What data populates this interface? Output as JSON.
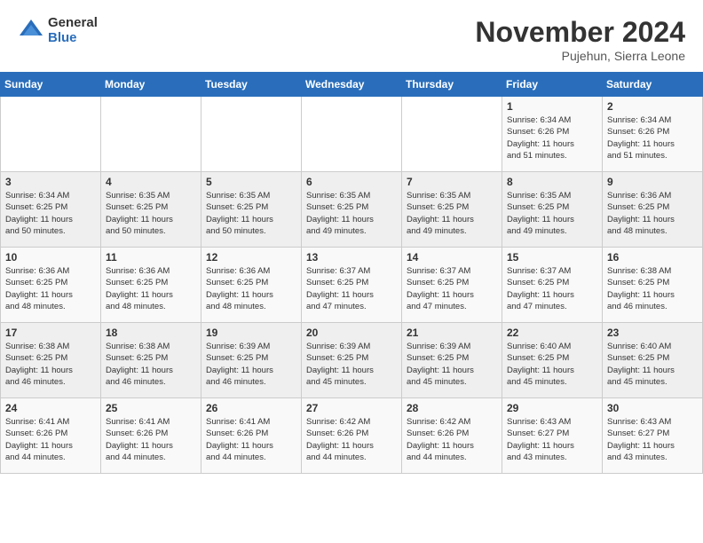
{
  "header": {
    "logo_general": "General",
    "logo_blue": "Blue",
    "month": "November 2024",
    "location": "Pujehun, Sierra Leone"
  },
  "days_of_week": [
    "Sunday",
    "Monday",
    "Tuesday",
    "Wednesday",
    "Thursday",
    "Friday",
    "Saturday"
  ],
  "weeks": [
    [
      {
        "day": "",
        "info": ""
      },
      {
        "day": "",
        "info": ""
      },
      {
        "day": "",
        "info": ""
      },
      {
        "day": "",
        "info": ""
      },
      {
        "day": "",
        "info": ""
      },
      {
        "day": "1",
        "info": "Sunrise: 6:34 AM\nSunset: 6:26 PM\nDaylight: 11 hours\nand 51 minutes."
      },
      {
        "day": "2",
        "info": "Sunrise: 6:34 AM\nSunset: 6:26 PM\nDaylight: 11 hours\nand 51 minutes."
      }
    ],
    [
      {
        "day": "3",
        "info": "Sunrise: 6:34 AM\nSunset: 6:25 PM\nDaylight: 11 hours\nand 50 minutes."
      },
      {
        "day": "4",
        "info": "Sunrise: 6:35 AM\nSunset: 6:25 PM\nDaylight: 11 hours\nand 50 minutes."
      },
      {
        "day": "5",
        "info": "Sunrise: 6:35 AM\nSunset: 6:25 PM\nDaylight: 11 hours\nand 50 minutes."
      },
      {
        "day": "6",
        "info": "Sunrise: 6:35 AM\nSunset: 6:25 PM\nDaylight: 11 hours\nand 49 minutes."
      },
      {
        "day": "7",
        "info": "Sunrise: 6:35 AM\nSunset: 6:25 PM\nDaylight: 11 hours\nand 49 minutes."
      },
      {
        "day": "8",
        "info": "Sunrise: 6:35 AM\nSunset: 6:25 PM\nDaylight: 11 hours\nand 49 minutes."
      },
      {
        "day": "9",
        "info": "Sunrise: 6:36 AM\nSunset: 6:25 PM\nDaylight: 11 hours\nand 48 minutes."
      }
    ],
    [
      {
        "day": "10",
        "info": "Sunrise: 6:36 AM\nSunset: 6:25 PM\nDaylight: 11 hours\nand 48 minutes."
      },
      {
        "day": "11",
        "info": "Sunrise: 6:36 AM\nSunset: 6:25 PM\nDaylight: 11 hours\nand 48 minutes."
      },
      {
        "day": "12",
        "info": "Sunrise: 6:36 AM\nSunset: 6:25 PM\nDaylight: 11 hours\nand 48 minutes."
      },
      {
        "day": "13",
        "info": "Sunrise: 6:37 AM\nSunset: 6:25 PM\nDaylight: 11 hours\nand 47 minutes."
      },
      {
        "day": "14",
        "info": "Sunrise: 6:37 AM\nSunset: 6:25 PM\nDaylight: 11 hours\nand 47 minutes."
      },
      {
        "day": "15",
        "info": "Sunrise: 6:37 AM\nSunset: 6:25 PM\nDaylight: 11 hours\nand 47 minutes."
      },
      {
        "day": "16",
        "info": "Sunrise: 6:38 AM\nSunset: 6:25 PM\nDaylight: 11 hours\nand 46 minutes."
      }
    ],
    [
      {
        "day": "17",
        "info": "Sunrise: 6:38 AM\nSunset: 6:25 PM\nDaylight: 11 hours\nand 46 minutes."
      },
      {
        "day": "18",
        "info": "Sunrise: 6:38 AM\nSunset: 6:25 PM\nDaylight: 11 hours\nand 46 minutes."
      },
      {
        "day": "19",
        "info": "Sunrise: 6:39 AM\nSunset: 6:25 PM\nDaylight: 11 hours\nand 46 minutes."
      },
      {
        "day": "20",
        "info": "Sunrise: 6:39 AM\nSunset: 6:25 PM\nDaylight: 11 hours\nand 45 minutes."
      },
      {
        "day": "21",
        "info": "Sunrise: 6:39 AM\nSunset: 6:25 PM\nDaylight: 11 hours\nand 45 minutes."
      },
      {
        "day": "22",
        "info": "Sunrise: 6:40 AM\nSunset: 6:25 PM\nDaylight: 11 hours\nand 45 minutes."
      },
      {
        "day": "23",
        "info": "Sunrise: 6:40 AM\nSunset: 6:25 PM\nDaylight: 11 hours\nand 45 minutes."
      }
    ],
    [
      {
        "day": "24",
        "info": "Sunrise: 6:41 AM\nSunset: 6:26 PM\nDaylight: 11 hours\nand 44 minutes."
      },
      {
        "day": "25",
        "info": "Sunrise: 6:41 AM\nSunset: 6:26 PM\nDaylight: 11 hours\nand 44 minutes."
      },
      {
        "day": "26",
        "info": "Sunrise: 6:41 AM\nSunset: 6:26 PM\nDaylight: 11 hours\nand 44 minutes."
      },
      {
        "day": "27",
        "info": "Sunrise: 6:42 AM\nSunset: 6:26 PM\nDaylight: 11 hours\nand 44 minutes."
      },
      {
        "day": "28",
        "info": "Sunrise: 6:42 AM\nSunset: 6:26 PM\nDaylight: 11 hours\nand 44 minutes."
      },
      {
        "day": "29",
        "info": "Sunrise: 6:43 AM\nSunset: 6:27 PM\nDaylight: 11 hours\nand 43 minutes."
      },
      {
        "day": "30",
        "info": "Sunrise: 6:43 AM\nSunset: 6:27 PM\nDaylight: 11 hours\nand 43 minutes."
      }
    ]
  ]
}
